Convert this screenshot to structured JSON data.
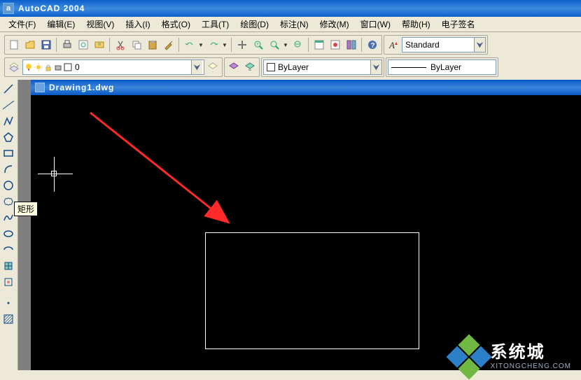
{
  "title": "AutoCAD 2004",
  "menu": [
    "文件(F)",
    "编辑(E)",
    "视图(V)",
    "插入(I)",
    "格式(O)",
    "工具(T)",
    "绘图(D)",
    "标注(N)",
    "修改(M)",
    "窗口(W)",
    "帮助(H)",
    "电子签名"
  ],
  "layer_name": "0",
  "bylayer": "ByLayer",
  "lineweight": "ByLayer",
  "text_style": "Standard",
  "drawing_file": "Drawing1.dwg",
  "tooltip": "矩形",
  "watermark": {
    "main": "系统城",
    "sub": "XITONGCHENG.COM"
  }
}
